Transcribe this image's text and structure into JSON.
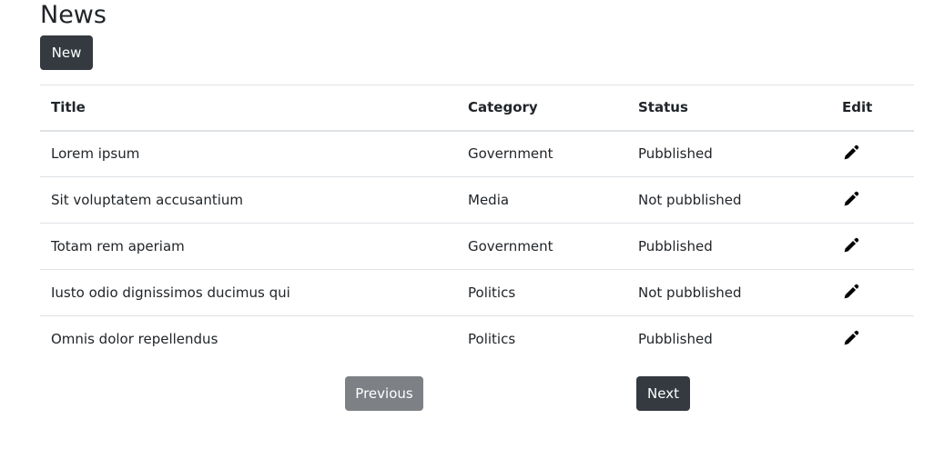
{
  "header": {
    "title": "News",
    "new_button_label": "New"
  },
  "table": {
    "columns": [
      "Title",
      "Category",
      "Status",
      "Edit"
    ],
    "rows": [
      {
        "title": "Lorem ipsum",
        "category": "Government",
        "status": "Pubblished",
        "edit_icon": "pencil-icon"
      },
      {
        "title": "Sit voluptatem accusantium",
        "category": "Media",
        "status": "Not pubblished",
        "edit_icon": "pencil-icon"
      },
      {
        "title": "Totam rem aperiam",
        "category": "Government",
        "status": "Pubblished",
        "edit_icon": "pencil-icon"
      },
      {
        "title": "Iusto odio dignissimos ducimus qui",
        "category": "Politics",
        "status": "Not pubblished",
        "edit_icon": "pencil-icon"
      },
      {
        "title": "Omnis dolor repellendus",
        "category": "Politics",
        "status": "Pubblished",
        "edit_icon": "pencil-icon"
      }
    ]
  },
  "pagination": {
    "previous_label": "Previous",
    "next_label": "Next"
  },
  "colors": {
    "dark_button": "#343a40",
    "disabled_button": "#7d8085",
    "border": "#dee2e6",
    "text": "#212529"
  }
}
